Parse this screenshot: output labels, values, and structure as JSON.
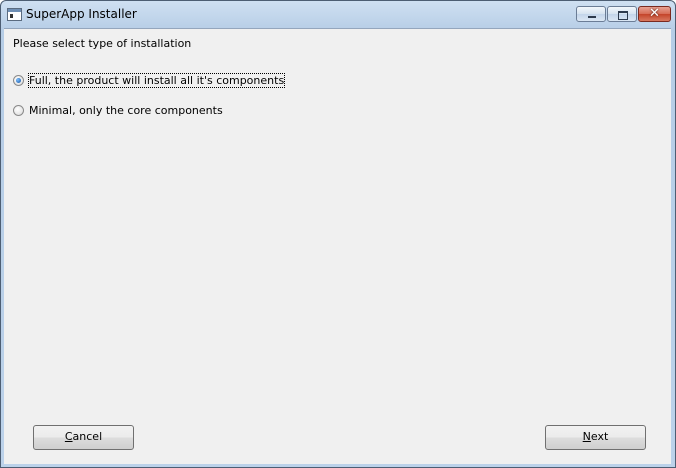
{
  "window": {
    "title": "SuperApp Installer",
    "controls": {
      "minimize_icon": "minimize-icon",
      "maximize_icon": "maximize-icon",
      "close_icon": "close-icon",
      "close_glyph": "✕"
    }
  },
  "content": {
    "prompt": "Please select type of installation",
    "options": [
      {
        "label": "Full, the product will install all it's components",
        "selected": true
      },
      {
        "label": "Minimal, only the core components",
        "selected": false
      }
    ]
  },
  "buttons": {
    "cancel": {
      "accel": "C",
      "rest": "ancel"
    },
    "next": {
      "accel": "N",
      "rest": "ext"
    }
  },
  "colors": {
    "title_bar": "#bcd2ea",
    "client_bg": "#f0f0f0",
    "close_button": "#c4442a"
  }
}
